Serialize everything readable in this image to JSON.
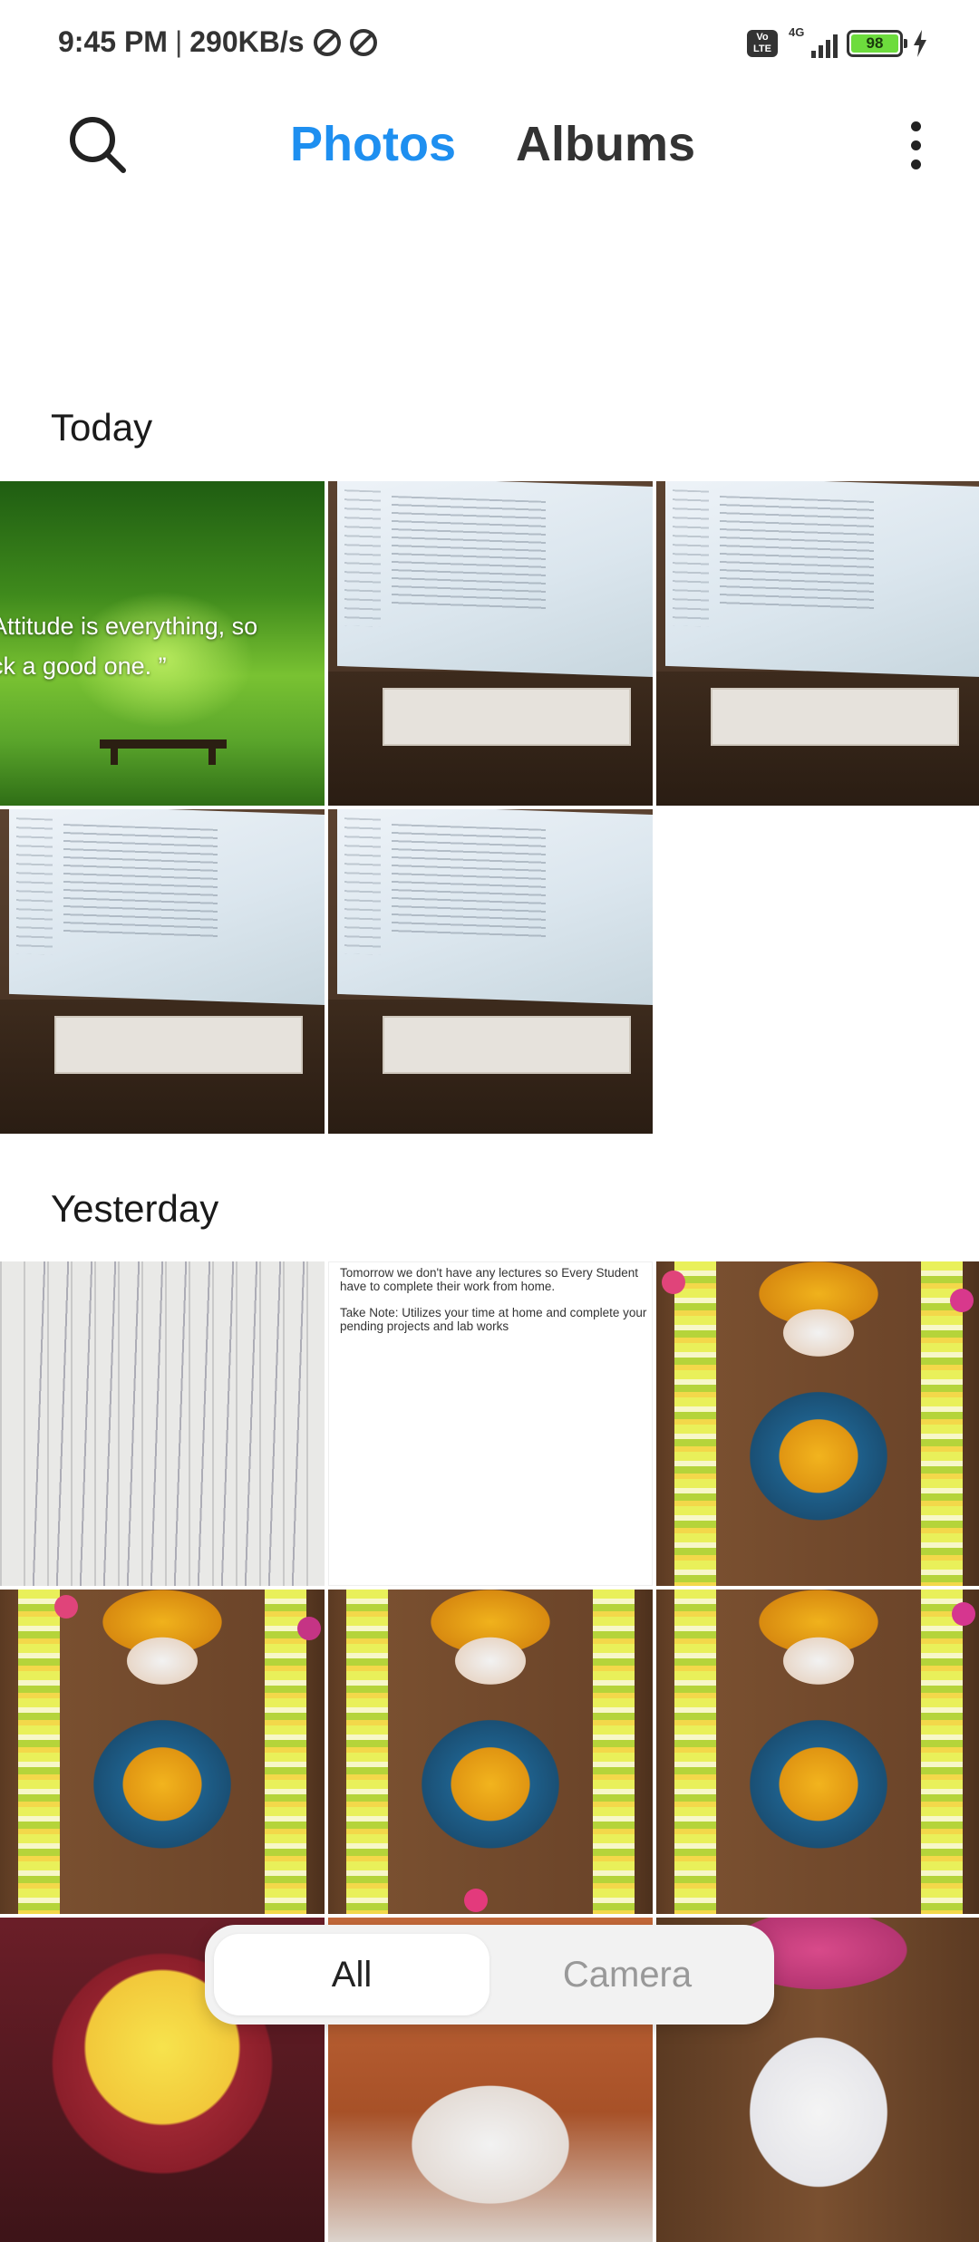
{
  "status_bar": {
    "time": "9:45 PM",
    "separator": "|",
    "speed": "290KB/s",
    "volte": "Vo LTE",
    "network": "4G",
    "battery": "98"
  },
  "header": {
    "tabs": [
      {
        "label": "Photos",
        "active": true
      },
      {
        "label": "Albums",
        "active": false
      }
    ],
    "accent_color": "#1e8ff0"
  },
  "sections": [
    {
      "title": "Today"
    },
    {
      "title": "Yesterday"
    }
  ],
  "photos": {
    "today_nature_quote": "Attitude is everything, so\nck a good one. ”",
    "yesterday_note_line1": "Tomorrow we don't have any lectures so Every Student have to complete their work from home.",
    "yesterday_note_line2": "Take Note: Utilizes your time at home and complete your pending projects and lab works"
  },
  "filter": {
    "options": [
      {
        "label": "All",
        "active": true
      },
      {
        "label": "Camera",
        "active": false
      }
    ]
  }
}
